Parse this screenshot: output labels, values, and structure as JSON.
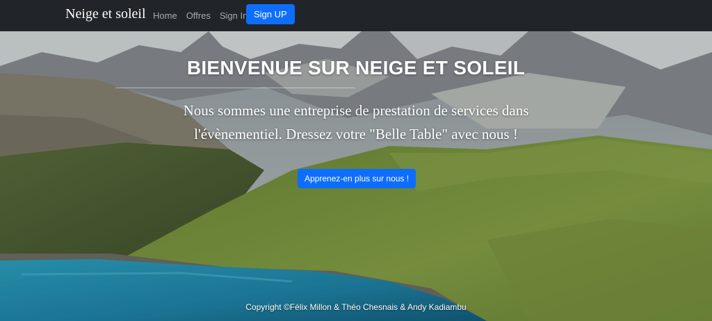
{
  "navbar": {
    "brand": "Neige et soleil",
    "links": [
      "Home",
      "Offres",
      "Sign In"
    ],
    "signup_label": "Sign UP"
  },
  "hero": {
    "title": "BIENVENUE SUR NEIGE ET SOLEIL",
    "lead": "Nous sommes une entreprise de prestation de services dans l'évènementiel. Dressez votre \"Belle Table\" avec nous !",
    "cta_label": "Apprenez-en plus sur nous !",
    "background": "mountain-lake-landscape"
  },
  "footer": {
    "copyright": "Copyright ©Félix Millon & Théo Chesnais & Andy Kadiambu"
  },
  "colors": {
    "navbar_bg": "#212529",
    "primary": "#0d6efd",
    "lake": "#1d8fb6",
    "grass": "#7e9a3b"
  }
}
